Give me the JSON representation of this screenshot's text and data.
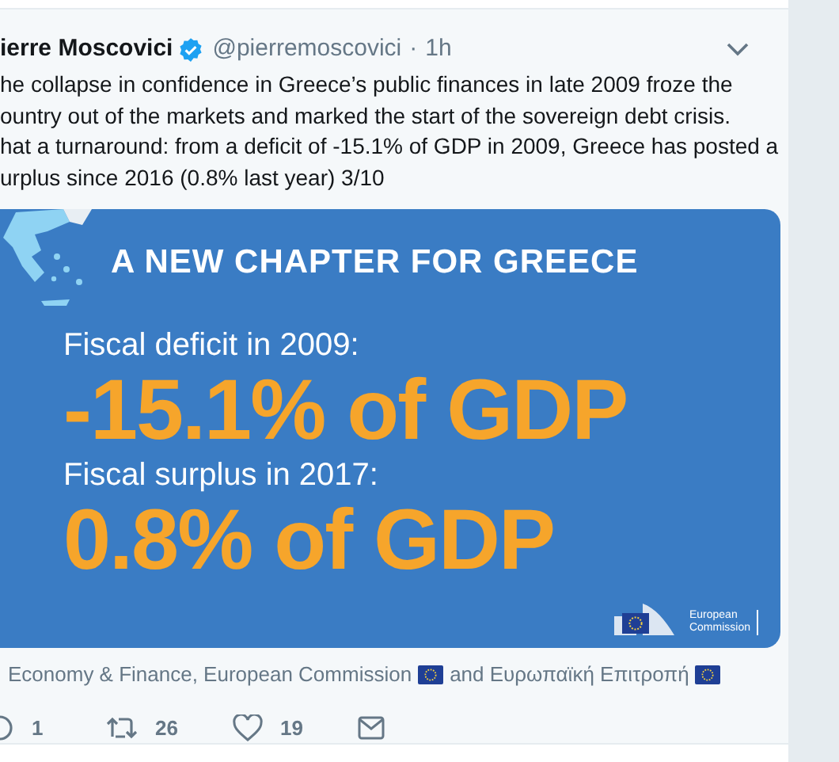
{
  "tweet": {
    "author": "ierre Moscovici",
    "verified": true,
    "handle": "@pierremoscovici",
    "separator": "·",
    "time": "1h",
    "text_lines": [
      "he collapse in confidence in Greece’s public finances in late 2009 froze the",
      "ountry out of the markets and marked the start of the sovereign debt crisis.",
      "hat a turnaround: from a deficit of -15.1% of GDP in 2009, Greece has posted a",
      "urplus since 2016 (0.8% last year) 3/10"
    ],
    "graphic": {
      "title": "A NEW CHAPTER FOR GREECE",
      "items": [
        {
          "label": "Fiscal deficit in 2009:",
          "value": "-15.1% of GDP"
        },
        {
          "label": "Fiscal surplus in 2017:",
          "value": "0.8% of GDP"
        }
      ],
      "logo_text": [
        "European",
        "Commission"
      ]
    },
    "tags": [
      {
        "text": "Economy & Finance, European Commission"
      },
      {
        "text": "and Ευρωπαϊκή Επιτροπή"
      }
    ],
    "actions": [
      {
        "kind": "reply",
        "count": "1"
      },
      {
        "kind": "retweet",
        "count": "26"
      },
      {
        "kind": "like",
        "count": "19"
      },
      {
        "kind": "message"
      }
    ]
  }
}
